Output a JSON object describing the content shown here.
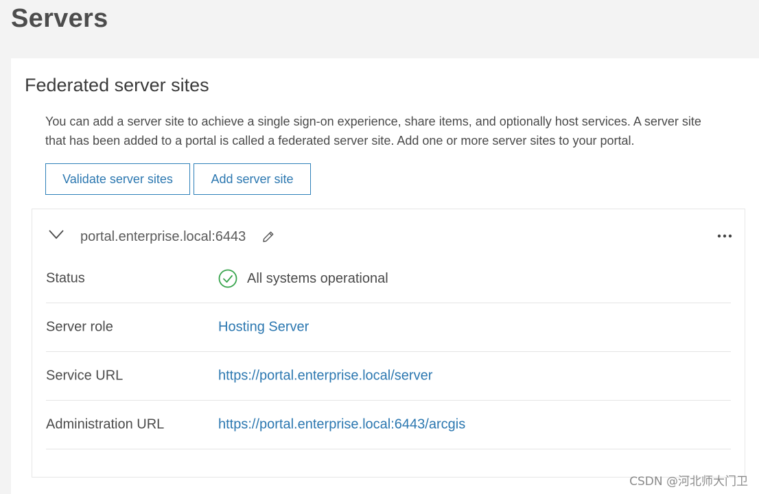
{
  "page": {
    "title": "Servers"
  },
  "section": {
    "title": "Federated server sites",
    "description": "You can add a server site to achieve a single sign-on experience, share items, and optionally host services. A server site that has been added to a portal is called a federated server site. Add one or more server sites to your portal."
  },
  "buttons": {
    "validate": "Validate server sites",
    "add": "Add server site"
  },
  "server": {
    "hostname": "portal.enterprise.local:6443",
    "expand_icon": "chevron-down-icon",
    "edit_icon": "pencil-icon",
    "more_icon": "more-horizontal-icon",
    "rows": [
      {
        "label": "Status",
        "value": "All systems operational",
        "icon": "check-circle-icon",
        "status_color": "#35a34a"
      },
      {
        "label": "Server role",
        "value": "Hosting Server"
      },
      {
        "label": "Service URL",
        "value": "https://portal.enterprise.local/server"
      },
      {
        "label": "Administration URL",
        "value": "https://portal.enterprise.local:6443/arcgis"
      }
    ]
  },
  "watermark": "CSDN @河北师大门卫",
  "colors": {
    "accent": "#2b77b0",
    "success": "#35a34a"
  }
}
